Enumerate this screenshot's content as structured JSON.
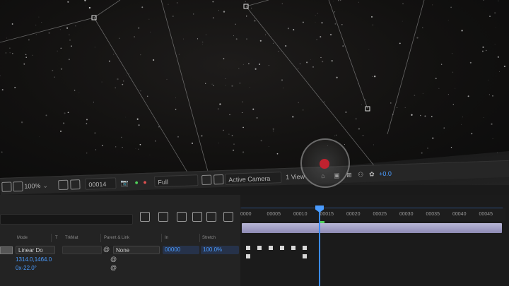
{
  "viewer_toolbar": {
    "zoom": "100%",
    "timecode": "00014",
    "resolution": "Full",
    "view_camera": "Active Camera",
    "view_layout": "1 View",
    "exposure": "+0.0"
  },
  "timeline": {
    "columns": {
      "mode": "Mode",
      "t": "T",
      "trkmat": "TrkMat",
      "parent_link": "Parent & Link",
      "in": "In",
      "stretch": "Stretch"
    },
    "layer": {
      "mode_value": "Linear Do",
      "parent_value": "None",
      "in_value": "00000",
      "stretch_value": "100.0%"
    },
    "property_values": {
      "position": "1314.0,1464.0",
      "rotation": "0x-22.0°"
    },
    "ruler_labels": [
      "0000",
      "00005",
      "00010",
      "00015",
      "00020",
      "00025",
      "00030",
      "00035",
      "00040",
      "00045"
    ],
    "current_frame": 14
  },
  "colors": {
    "accent": "#4a9cff",
    "layer_bar": "#a9a7cf",
    "cursor_dot": "#c0222f"
  }
}
